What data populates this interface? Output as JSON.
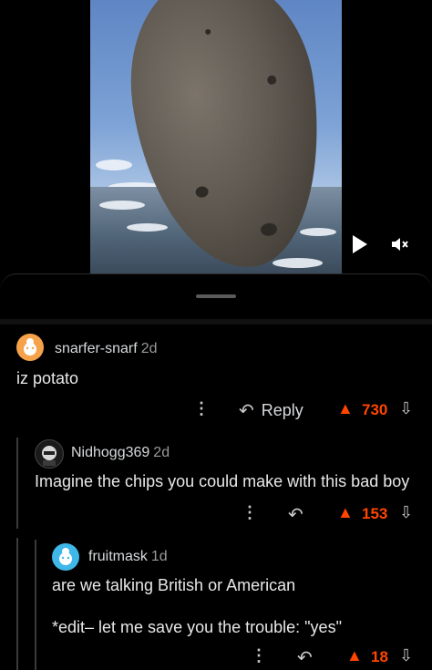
{
  "video": {
    "play_icon": "play-icon",
    "mute_icon": "mute-icon"
  },
  "comments": [
    {
      "username": "snarfer-snarf",
      "age": "2d",
      "text": "iz potato",
      "reply_label": "Reply",
      "score": "730"
    },
    {
      "username": "Nidhogg369",
      "age": "2d",
      "text": "Imagine the chips you could make with this bad boy",
      "score": "153"
    },
    {
      "username": "fruitmask",
      "age": "1d",
      "text": "are we talking British or American",
      "edit_text": "*edit– let me save you the trouble: \"yes\"",
      "score": "18"
    }
  ],
  "colors": {
    "upvote": "#ff4500",
    "avatar1": "#f6a24a",
    "avatar3": "#3fb7e8"
  }
}
